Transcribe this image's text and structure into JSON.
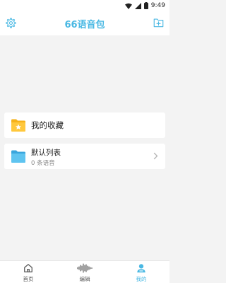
{
  "status_bar": {
    "time": "9:49"
  },
  "header": {
    "title": "66语音包",
    "settings_icon": "gear-icon",
    "add_icon": "add-folder-icon"
  },
  "favorites": {
    "label": "我的收藏",
    "icon": "star-folder-icon"
  },
  "default_list": {
    "title": "默认列表",
    "count": "0 条语音",
    "icon": "folder-icon"
  },
  "bottom_nav": {
    "items": [
      {
        "label": "首页",
        "icon": "home-icon",
        "active": false
      },
      {
        "label": "编辑",
        "icon": "waveform-icon",
        "active": false
      },
      {
        "label": "我的",
        "icon": "user-icon",
        "active": true
      }
    ]
  },
  "colors": {
    "accent": "#49b8e3",
    "folder": "#f6b21a",
    "list_folder": "#4db7ea"
  }
}
